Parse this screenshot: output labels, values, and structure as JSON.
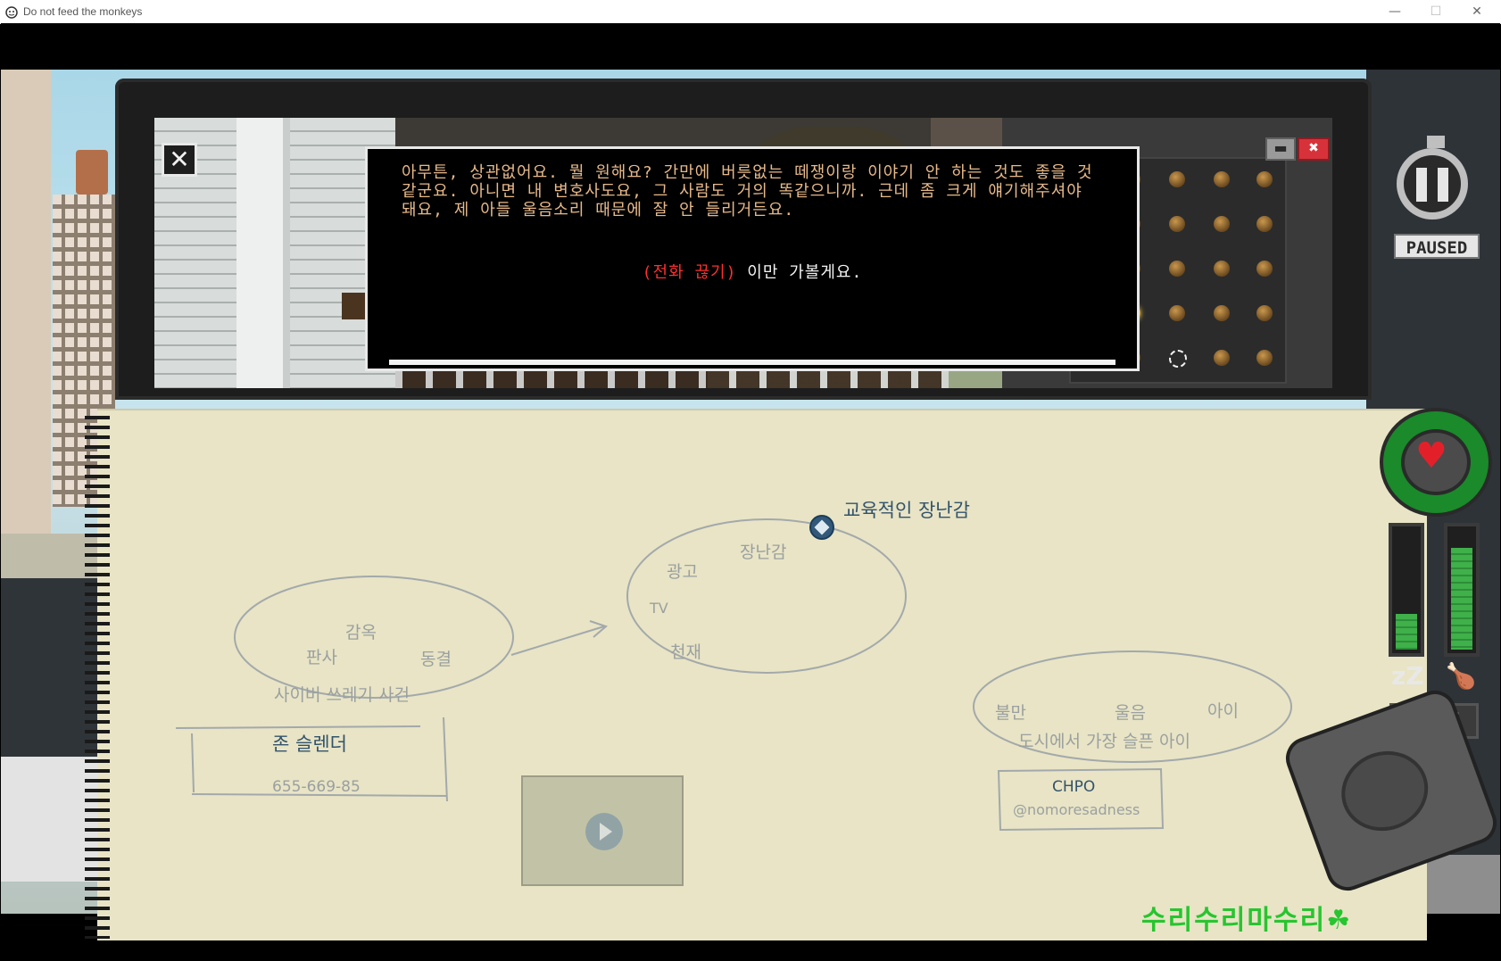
{
  "window": {
    "title": "Do not feed the monkeys",
    "minimize_glyph": "—",
    "maximize_glyph": "☐",
    "close_glyph": "✕"
  },
  "video_window": {
    "close_glyph": "✕",
    "minimize_glyph": "▬",
    "close2_glyph": "✖"
  },
  "dialog": {
    "text": "아무튼, 상관없어요. 뭘 원해요? 간만에 버릇없는 떼쟁이랑 이야기 안 하는 것도 좋을 것\n같군요. 아니면 내 변호사도요, 그 사람도 거의 똑같으니까. 근데 좀 크게 얘기해주셔야\n돼요, 제 아들 울음소리 때문에 잘 안 들리거든요.",
    "choice_tag": "(전화 끊기)",
    "choice_text": " 이만 가볼게요."
  },
  "pause": {
    "label": "PAUSED"
  },
  "notebook": {
    "cluster_1": {
      "words": [
        "감옥",
        "판사",
        "동결",
        "사이버 쓰레기 사건"
      ]
    },
    "cluster_2": {
      "words": [
        "장난감",
        "광고",
        "TV",
        "천재"
      ],
      "pinned_topic": "교육적인 장난감"
    },
    "cluster_3": {
      "words": [
        "불만",
        "울음",
        "아이",
        "도시에서 가장 슬픈 아이"
      ]
    },
    "contact_1": {
      "name": "존 슬렌더",
      "phone": "655-669-85"
    },
    "contact_2": {
      "name": "CHPO",
      "handle": "@nomoresadness"
    }
  },
  "hud": {
    "health_level": 0.9,
    "sleep_meter_level": 0.3,
    "food_meter_level": 0.85,
    "sleep_icon": "zz-sleep-icon",
    "food_icon": "chicken-leg-icon",
    "money": "$537"
  },
  "watermark": "수리수리마수리",
  "colors": {
    "dialog_text": "#e7b98a",
    "choice_tag": "#ff3030",
    "health_green": "#1a8a2a",
    "heart": "#e3202a",
    "watermark": "#27c52f",
    "notebook_paper": "#e8e4c5"
  }
}
